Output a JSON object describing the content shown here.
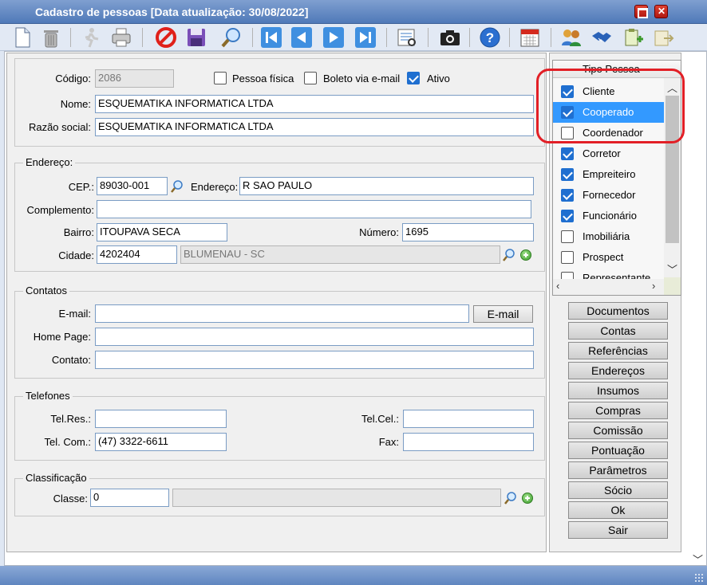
{
  "window": {
    "title": "Cadastro de pessoas [Data atualização: 30/08/2022]"
  },
  "toolbar": {
    "icons": [
      "new-document-icon",
      "delete-trash-icon",
      "run-icon",
      "print-icon",
      "cancel-icon",
      "save-icon",
      "search-icon",
      "first-record-icon",
      "previous-record-icon",
      "next-record-icon",
      "last-record-icon",
      "preview-icon",
      "camera-icon",
      "help-icon",
      "calendar-icon",
      "users-icon",
      "handshake-icon",
      "paste-icon",
      "export-icon"
    ]
  },
  "identificacao": {
    "codigo_label": "Código:",
    "codigo_value": "2086",
    "pessoa_fisica_label": "Pessoa física",
    "pessoa_fisica_checked": false,
    "boleto_label": "Boleto via e-mail",
    "boleto_checked": false,
    "ativo_label": "Ativo",
    "ativo_checked": true,
    "nome_label": "Nome:",
    "nome_value": "ESQUEMATIKA INFORMATICA LTDA",
    "razao_label": "Razão social:",
    "razao_value": "ESQUEMATIKA INFORMATICA LTDA"
  },
  "endereco": {
    "legend": "Endereço:",
    "cep_label": "CEP.:",
    "cep_value": "89030-001",
    "endereco_label": "Endereço:",
    "endereco_value": "R SAO PAULO",
    "complemento_label": "Complemento:",
    "complemento_value": "",
    "bairro_label": "Bairro:",
    "bairro_value": "ITOUPAVA SECA",
    "numero_label": "Número:",
    "numero_value": "1695",
    "cidade_label": "Cidade:",
    "cidade_value": "4202404",
    "cidade_nome": "BLUMENAU - SC"
  },
  "contatos": {
    "legend": "Contatos",
    "email_label": "E-mail:",
    "email_value": "",
    "email_button": "E-mail",
    "homepage_label": "Home Page:",
    "homepage_value": "",
    "contato_label": "Contato:",
    "contato_value": ""
  },
  "telefones": {
    "legend": "Telefones",
    "telres_label": "Tel.Res.:",
    "telres_value": "",
    "telcel_label": "Tel.Cel.:",
    "telcel_value": "",
    "telcom_label": "Tel. Com.:",
    "telcom_value": "(47) 3322-6611",
    "fax_label": "Fax:",
    "fax_value": ""
  },
  "classificacao": {
    "legend": "Classificação",
    "classe_label": "Classe:",
    "classe_value": "0",
    "classe_desc": ""
  },
  "tipo_pessoa": {
    "header": "Tipo Pessoa",
    "items": [
      {
        "label": "Cliente",
        "checked": true,
        "selected": false
      },
      {
        "label": "Cooperado",
        "checked": true,
        "selected": true
      },
      {
        "label": "Coordenador",
        "checked": false,
        "selected": false
      },
      {
        "label": "Corretor",
        "checked": true,
        "selected": false
      },
      {
        "label": "Empreiteiro",
        "checked": true,
        "selected": false
      },
      {
        "label": "Fornecedor",
        "checked": true,
        "selected": false
      },
      {
        "label": "Funcionário",
        "checked": true,
        "selected": false
      },
      {
        "label": "Imobiliária",
        "checked": false,
        "selected": false
      },
      {
        "label": "Prospect",
        "checked": false,
        "selected": false
      },
      {
        "label": "Representante",
        "checked": false,
        "selected": false
      }
    ]
  },
  "side_buttons": [
    "Documentos",
    "Contas",
    "Referências",
    "Endereços",
    "Insumos",
    "Compras",
    "Comissão",
    "Pontuação",
    "Parâmetros",
    "Sócio",
    "Ok",
    "Sair"
  ],
  "colors": {
    "accent": "#3399ff",
    "highlight": "#e21f26",
    "titlebar": "#5f86c0"
  }
}
